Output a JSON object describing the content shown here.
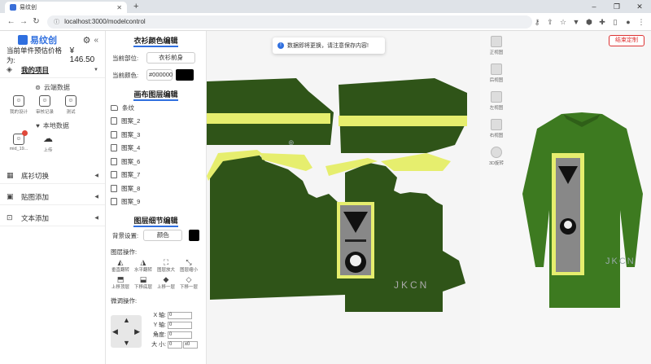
{
  "browser": {
    "tab_title": "易纹创",
    "url": "localhost:3000/modelcontrol",
    "new_tab": "+",
    "controls": [
      "–",
      "❐",
      "✕"
    ]
  },
  "sidebar": {
    "logo_text": "易纹创",
    "price_label": "当前单件预估价格为:",
    "price_value": "¥ 146.50",
    "my_projects": "我的项目",
    "cloud_data": "云端数据",
    "cloud_items": [
      "我的设计",
      "审核记录",
      "测试"
    ],
    "local_data": "本地数据",
    "local_items": [
      "mid_19...",
      "上传"
    ],
    "menu": [
      {
        "label": "底衫切换",
        "icon": "swap-icon"
      },
      {
        "label": "贴图添加",
        "icon": "image-icon"
      },
      {
        "label": "文本添加",
        "icon": "text-icon"
      }
    ]
  },
  "layer_panel": {
    "color_title": "衣衫颜色编辑",
    "part_label": "当前部位:",
    "part_value": "衣衫前身",
    "color_label": "当前颜色:",
    "color_value": "#000000",
    "canvas_title": "画布图层编辑",
    "layers": [
      "条纹",
      "图案_2",
      "图案_3",
      "图案_4",
      "图案_6",
      "图案_7",
      "图案_8",
      "图案_9"
    ],
    "detail_title": "图层细节编辑",
    "bg_label": "背景设置:",
    "bg_value": "颜色",
    "ops_label": "图层操作:",
    "ops": [
      {
        "label": "垂直翻转",
        "icon": "flip-vertical-icon"
      },
      {
        "label": "水平翻转",
        "icon": "flip-horizontal-icon"
      },
      {
        "label": "图层放大",
        "icon": "zoom-in-icon"
      },
      {
        "label": "图层缩小",
        "icon": "zoom-out-icon"
      },
      {
        "label": "上移顶层",
        "icon": "bring-top-icon"
      },
      {
        "label": "下移底层",
        "icon": "send-bottom-icon"
      },
      {
        "label": "上移一层",
        "icon": "bring-forward-icon"
      },
      {
        "label": "下移一层",
        "icon": "send-backward-icon"
      }
    ],
    "fine_label": "微调操作:",
    "coords": [
      {
        "label": "X 轴:",
        "value": "0"
      },
      {
        "label": "Y 轴:",
        "value": "0"
      },
      {
        "label": "角度:",
        "value": "0"
      },
      {
        "label": "大 小:",
        "value": "0"
      }
    ],
    "size_suffix": "x0"
  },
  "toast": {
    "text": "数据即将更换，请注意保存内容!"
  },
  "views": [
    "正视图",
    "后视图",
    "左视图",
    "右视图",
    "3D旋转"
  ],
  "end_button": "结束定制",
  "garment": {
    "brand_text": "JKCN",
    "color": "#2f5418",
    "accent": "#e6ee6e"
  }
}
